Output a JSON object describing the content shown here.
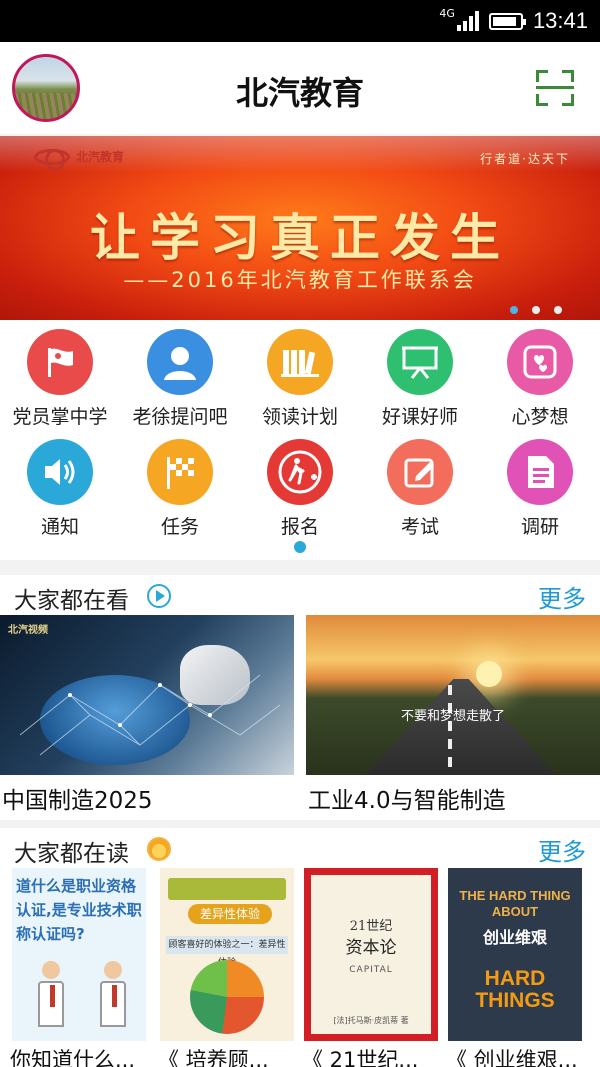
{
  "status_bar": {
    "network": "4G",
    "signal_level": 4,
    "battery_level": 0.9,
    "time": "13:41"
  },
  "header": {
    "title": "北汽教育",
    "avatar_icon": "avatar-photo",
    "scan_icon": "scan-icon"
  },
  "banner": {
    "logo_text": "北汽教育",
    "slogan": "行者道·达天下",
    "headline": "让学习真正发生",
    "subline": "——2016年北汽教育工作联系会",
    "slide_count": 3,
    "active_slide": 1
  },
  "functions": [
    {
      "label": "党员掌中学",
      "icon": "party-flag-icon",
      "color": "#e94b4b"
    },
    {
      "label": "老徐提问吧",
      "icon": "person-icon",
      "color": "#3b8fe0"
    },
    {
      "label": "领读计划",
      "icon": "books-icon",
      "color": "#f5a623"
    },
    {
      "label": "好课好师",
      "icon": "presentation-icon",
      "color": "#2fbf71"
    },
    {
      "label": "心梦想",
      "icon": "hearts-icon",
      "color": "#e85aa5"
    },
    {
      "label": "通知",
      "icon": "speaker-icon",
      "color": "#2aa8d8"
    },
    {
      "label": "任务",
      "icon": "checkered-flag-icon",
      "color": "#f5a623"
    },
    {
      "label": "报名",
      "icon": "walk-plus-icon",
      "color": "#e53935"
    },
    {
      "label": "考试",
      "icon": "edit-icon",
      "color": "#f26d5b"
    },
    {
      "label": "调研",
      "icon": "document-icon",
      "color": "#e052b6"
    }
  ],
  "watching": {
    "title": "大家都在看",
    "more": "更多",
    "items": [
      {
        "title": "中国制造2025",
        "thumb_label": "北汽视频"
      },
      {
        "title": "工业4.0与智能制造",
        "thumb_caption": "不要和梦想走散了"
      }
    ]
  },
  "reading": {
    "title": "大家都在读",
    "more": "更多",
    "items": [
      {
        "title": "你知道什么...",
        "cover_text": "道什么是职业资格认证,是专业技术职称认证吗?"
      },
      {
        "title": "《 培养顾...",
        "cover_tag": "差异性体验",
        "cover_sub": "顾客喜好的体验之一：差异性体验"
      },
      {
        "title": "《 21世纪...",
        "cover_line1": "21世纪",
        "cover_line2": "资本论",
        "cover_line3": "CAPITAL",
        "cover_line4": "[法]托马斯·皮凯蒂 著"
      },
      {
        "title": "《 创业维艰...",
        "cover_en1": "THE HARD THING ABOUT",
        "cover_cn": "创业维艰",
        "cover_en2": "HARD THINGS"
      }
    ]
  }
}
